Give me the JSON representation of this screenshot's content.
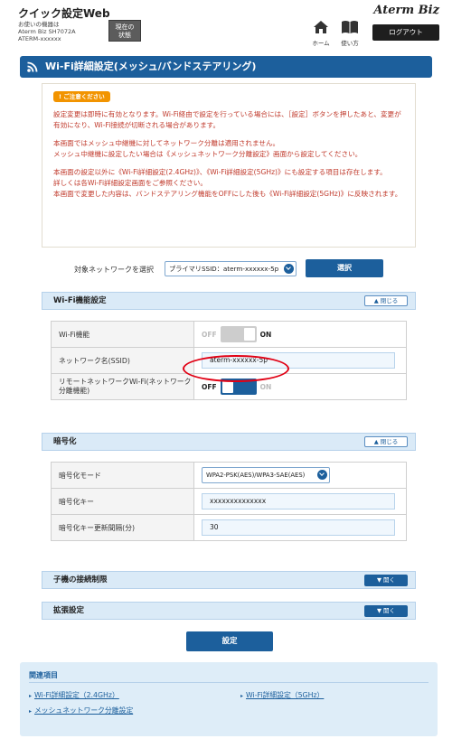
{
  "header": {
    "app_title": "クイック設定Web",
    "device_line1": "お使いの機器は",
    "device_line2": "Aterm Biz SH7072A",
    "device_line3": "ATERM-xxxxxx",
    "status_line1": "現在の",
    "status_line2": "状態",
    "brand": "Aterm Biz",
    "home_label": "ホーム",
    "usage_label": "使い方",
    "logout_label": "ログアウト"
  },
  "page": {
    "title": "Wi-Fi詳細設定(メッシュ/バンドステアリング)"
  },
  "notice": {
    "badge": "! ご注意ください",
    "p1": "設定変更は即時に有効となります。Wi-Fi経由で設定を行っている場合には、［設定］ボタンを押したあと、変更が有効になり、Wi-Fi接続が切断される場合があります。",
    "p2": "本画面ではメッシュ中継機に対してネットワーク分離は適用されません。",
    "p3": "メッシュ中継機に設定したい場合は《メッシュネットワーク分離設定》画面から設定してください。",
    "p4": "本画面の設定以外に《Wi-Fi詳細設定(2.4GHz)》、《Wi-Fi詳細設定(5GHz)》にも設定する項目は存在します。",
    "p5": "詳しくは各Wi-Fi詳細設定画面をご参照ください。",
    "p6": "本画面で変更した内容は、バンドステアリング機能をOFFにした後も《Wi-Fi詳細設定(5GHz)》に反映されます。"
  },
  "network_select": {
    "label": "対象ネットワークを選択",
    "selected": "プライマリSSID：aterm-xxxxxx-5p",
    "button": "選択"
  },
  "wifi_section": {
    "title": "Wi-Fi機能設定",
    "close_label": "▲ 閉じる",
    "rows": {
      "wifi_function": {
        "label": "Wi-Fi機能",
        "off": "OFF",
        "on": "ON"
      },
      "ssid": {
        "label": "ネットワーク名(SSID)",
        "value": "aterm-xxxxxx-5p"
      },
      "remote": {
        "label": "リモートネットワークWi-Fi(ネットワーク分離機能)",
        "off": "OFF",
        "on": "ON"
      }
    }
  },
  "encryption_section": {
    "title": "暗号化",
    "close_label": "▲ 閉じる",
    "rows": {
      "mode": {
        "label": "暗号化モード",
        "value": "WPA2-PSK(AES)/WPA3-SAE(AES)"
      },
      "key": {
        "label": "暗号化キー",
        "value": "xxxxxxxxxxxxxx"
      },
      "interval": {
        "label": "暗号化キー更新間隔(分)",
        "value": "30"
      }
    }
  },
  "client_limit_section": {
    "title": "子機の接続制限",
    "open_label": "▼ 開く"
  },
  "extended_section": {
    "title": "拡張設定",
    "open_label": "▼ 開く"
  },
  "submit_label": "設定",
  "related": {
    "title": "関連項目",
    "link1": "Wi-Fi詳細設定（2.4GHz）",
    "link2": "Wi-Fi詳細設定（5GHz）",
    "link3": "メッシュネットワーク分離設定"
  },
  "colors": {
    "primary": "#1c5f9c",
    "notice_text": "#c0392b",
    "highlight": "#e10014"
  }
}
